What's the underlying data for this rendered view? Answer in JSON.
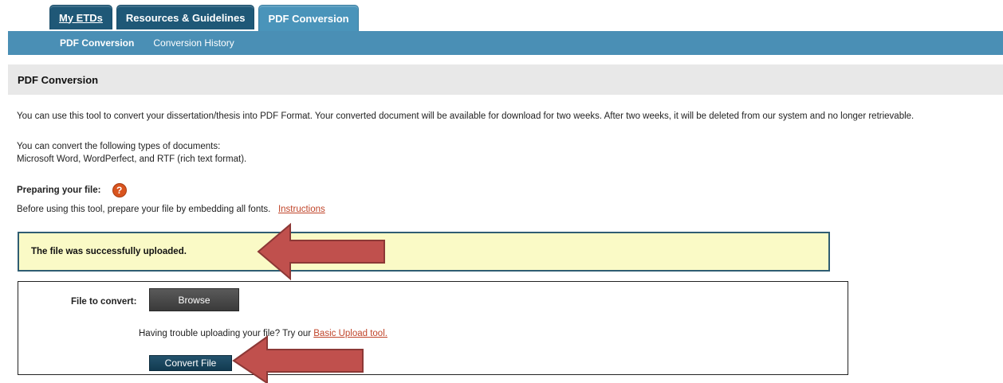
{
  "tabs": [
    {
      "label": "My ETDs"
    },
    {
      "label": "Resources & Guidelines"
    },
    {
      "label": "PDF Conversion"
    }
  ],
  "subnav": [
    "PDF Conversion",
    "Conversion History"
  ],
  "page": {
    "title": "PDF Conversion",
    "intro": "You can use this tool to convert your dissertation/thesis into PDF Format. Your converted document will be available for download for two weeks. After two weeks, it will be deleted from our system and no longer retrievable.",
    "types_heading": "You can convert the following types of documents:",
    "types_list": "Microsoft Word, WordPerfect, and RTF (rich text format).",
    "preparing_label": "Preparing your file:",
    "help_icon_glyph": "?",
    "preparing_text": "Before using this tool, prepare your file by embedding all fonts.",
    "instructions_link": "Instructions"
  },
  "notice": {
    "message": "The file was successfully uploaded."
  },
  "upload": {
    "file_label": "File to convert:",
    "browse_label": "Browse",
    "trouble_text": "Having trouble uploading your file? Try our ",
    "basic_upload_link": "Basic Upload tool.",
    "convert_label": "Convert File"
  },
  "colors": {
    "tab_dark": "#1f5877",
    "tab_active": "#4a94ba",
    "subnav": "#4a8fb5",
    "notice_bg": "#fafac6",
    "link": "#c0452a",
    "arrow": "#c0504d"
  }
}
